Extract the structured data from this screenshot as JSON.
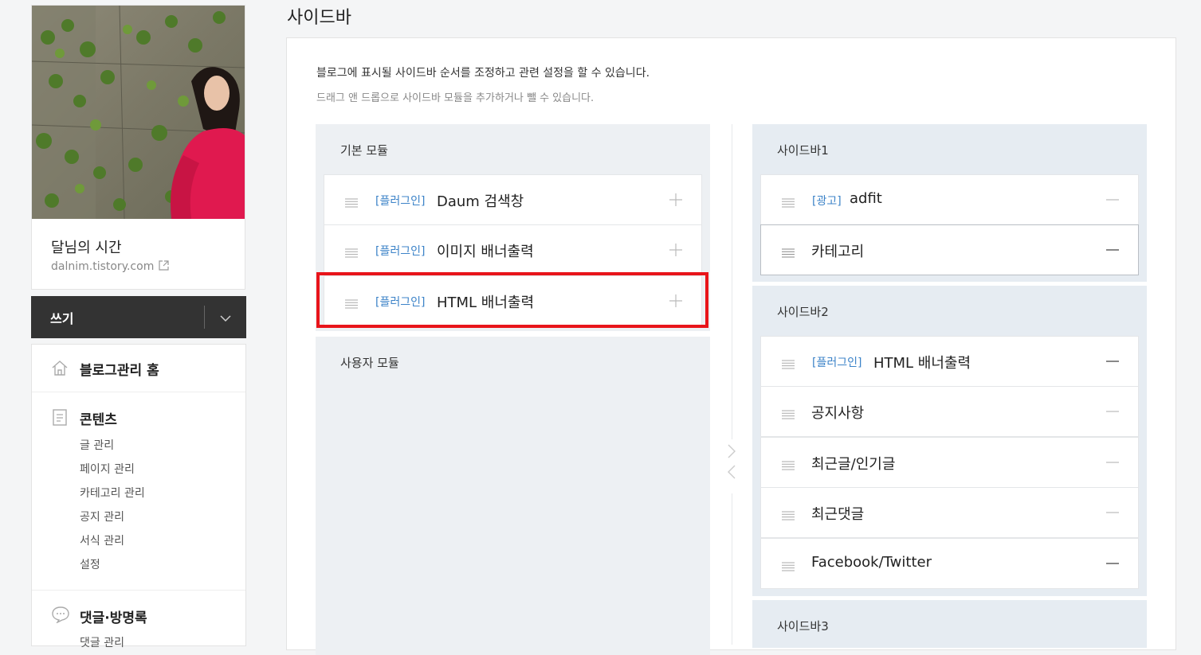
{
  "blog": {
    "title": "달님의 시간",
    "url": "dalnim.tistory.com"
  },
  "write": {
    "label": "쓰기"
  },
  "menu": {
    "home": "블로그관리 홈",
    "contents": {
      "title": "콘텐츠",
      "items": [
        "글 관리",
        "페이지 관리",
        "카테고리 관리",
        "공지 관리",
        "서식 관리",
        "설정"
      ]
    },
    "comments": {
      "title": "댓글·방명록",
      "items": [
        "댓글 관리"
      ]
    }
  },
  "page": {
    "title": "사이드바",
    "desc1": "블로그에 표시될 사이드바 순서를 조정하고 관련 설정을 할 수 있습니다.",
    "desc2": "드래그 앤 드롭으로 사이드바 모듈을 추가하거나 뺄 수 있습니다."
  },
  "modules": {
    "basic_title": "기본 모듈",
    "basic": [
      {
        "tag": "[플러그인]",
        "name": "Daum 검색창"
      },
      {
        "tag": "[플러그인]",
        "name": "이미지 배너출력"
      },
      {
        "tag": "[플러그인]",
        "name": "HTML 배너출력"
      }
    ],
    "user_title": "사용자 모듈"
  },
  "sidebars": [
    {
      "title": "사이드바1",
      "items": [
        {
          "tag": "[광고]",
          "name": "adfit"
        },
        {
          "tag": "",
          "name": "카테고리"
        }
      ]
    },
    {
      "title": "사이드바2",
      "items": [
        {
          "tag": "[플러그인]",
          "name": "HTML 배너출력"
        },
        {
          "tag": "",
          "name": "공지사항"
        },
        {
          "tag": "",
          "name": "최근글/인기글"
        },
        {
          "tag": "",
          "name": "최근댓글"
        },
        {
          "tag": "",
          "name": "Facebook/Twitter"
        }
      ]
    },
    {
      "title": "사이드바3",
      "items": []
    }
  ],
  "colors": {
    "tag_blue": "#3c83c8",
    "highlight_red": "#e8141a",
    "write_bar": "#333333",
    "sidebar_group_bg": "#e6ecf2"
  }
}
